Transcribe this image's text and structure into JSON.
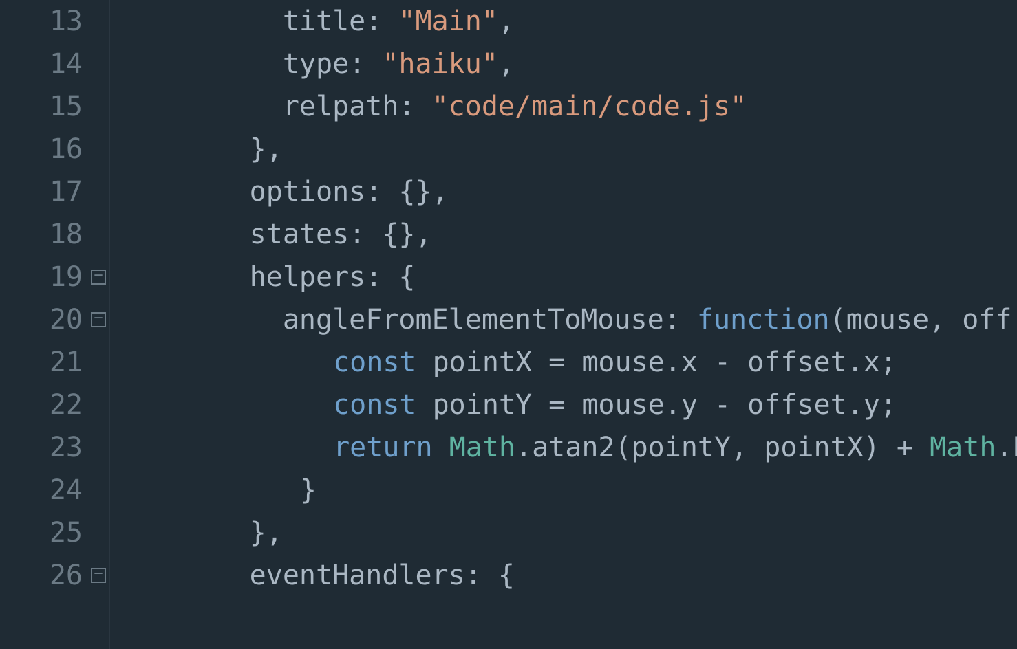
{
  "lines": [
    {
      "num": "13",
      "fold": false,
      "tokens": [
        {
          "t": "indent",
          "w": 5
        },
        {
          "t": "prop",
          "v": "title"
        },
        {
          "t": "punc",
          "v": ": "
        },
        {
          "t": "str",
          "v": "\"Main\""
        },
        {
          "t": "punc",
          "v": ","
        }
      ]
    },
    {
      "num": "14",
      "fold": false,
      "tokens": [
        {
          "t": "indent",
          "w": 5
        },
        {
          "t": "prop",
          "v": "type"
        },
        {
          "t": "punc",
          "v": ": "
        },
        {
          "t": "str",
          "v": "\"haiku\""
        },
        {
          "t": "punc",
          "v": ","
        }
      ]
    },
    {
      "num": "15",
      "fold": false,
      "tokens": [
        {
          "t": "indent",
          "w": 5
        },
        {
          "t": "prop",
          "v": "relpath"
        },
        {
          "t": "punc",
          "v": ": "
        },
        {
          "t": "str",
          "v": "\"code/main/code.js\""
        }
      ]
    },
    {
      "num": "16",
      "fold": false,
      "tokens": [
        {
          "t": "indent",
          "w": 4
        },
        {
          "t": "punc",
          "v": "},"
        }
      ]
    },
    {
      "num": "17",
      "fold": false,
      "tokens": [
        {
          "t": "indent",
          "w": 4
        },
        {
          "t": "prop",
          "v": "options"
        },
        {
          "t": "punc",
          "v": ": {},"
        }
      ]
    },
    {
      "num": "18",
      "fold": false,
      "tokens": [
        {
          "t": "indent",
          "w": 4
        },
        {
          "t": "prop",
          "v": "states"
        },
        {
          "t": "punc",
          "v": ": {},"
        }
      ]
    },
    {
      "num": "19",
      "fold": true,
      "tokens": [
        {
          "t": "indent",
          "w": 4
        },
        {
          "t": "prop",
          "v": "helpers"
        },
        {
          "t": "punc",
          "v": ": {"
        }
      ]
    },
    {
      "num": "20",
      "fold": true,
      "tokens": [
        {
          "t": "indent",
          "w": 5
        },
        {
          "t": "prop",
          "v": "angleFromElementToMouse"
        },
        {
          "t": "punc",
          "v": ": "
        },
        {
          "t": "kw",
          "v": "function"
        },
        {
          "t": "punc",
          "v": "(mouse, off"
        }
      ]
    },
    {
      "num": "21",
      "fold": false,
      "tokens": [
        {
          "t": "indent",
          "w": 5
        },
        {
          "t": "guide"
        },
        {
          "t": "indent",
          "w": 1
        },
        {
          "t": "kw",
          "v": "const"
        },
        {
          "t": "punc",
          "v": " pointX = mouse.x - offset.x;"
        }
      ]
    },
    {
      "num": "22",
      "fold": false,
      "tokens": [
        {
          "t": "indent",
          "w": 5
        },
        {
          "t": "guide"
        },
        {
          "t": "indent",
          "w": 1
        },
        {
          "t": "kw",
          "v": "const"
        },
        {
          "t": "punc",
          "v": " pointY = mouse.y - offset.y;"
        }
      ]
    },
    {
      "num": "23",
      "fold": false,
      "tokens": [
        {
          "t": "indent",
          "w": 5
        },
        {
          "t": "guide"
        },
        {
          "t": "indent",
          "w": 1
        },
        {
          "t": "kw",
          "v": "return"
        },
        {
          "t": "punc",
          "v": " "
        },
        {
          "t": "builtin",
          "v": "Math"
        },
        {
          "t": "punc",
          "v": ".atan2(pointY, pointX) + "
        },
        {
          "t": "builtin",
          "v": "Math"
        },
        {
          "t": "punc",
          "v": ".P"
        }
      ]
    },
    {
      "num": "24",
      "fold": false,
      "tokens": [
        {
          "t": "indent",
          "w": 5
        },
        {
          "t": "guide"
        },
        {
          "t": "punc",
          "v": "}"
        }
      ]
    },
    {
      "num": "25",
      "fold": false,
      "tokens": [
        {
          "t": "indent",
          "w": 4
        },
        {
          "t": "punc",
          "v": "},"
        }
      ]
    },
    {
      "num": "26",
      "fold": true,
      "tokens": [
        {
          "t": "indent",
          "w": 4
        },
        {
          "t": "prop",
          "v": "eventHandlers"
        },
        {
          "t": "punc",
          "v": ": {"
        }
      ]
    }
  ]
}
